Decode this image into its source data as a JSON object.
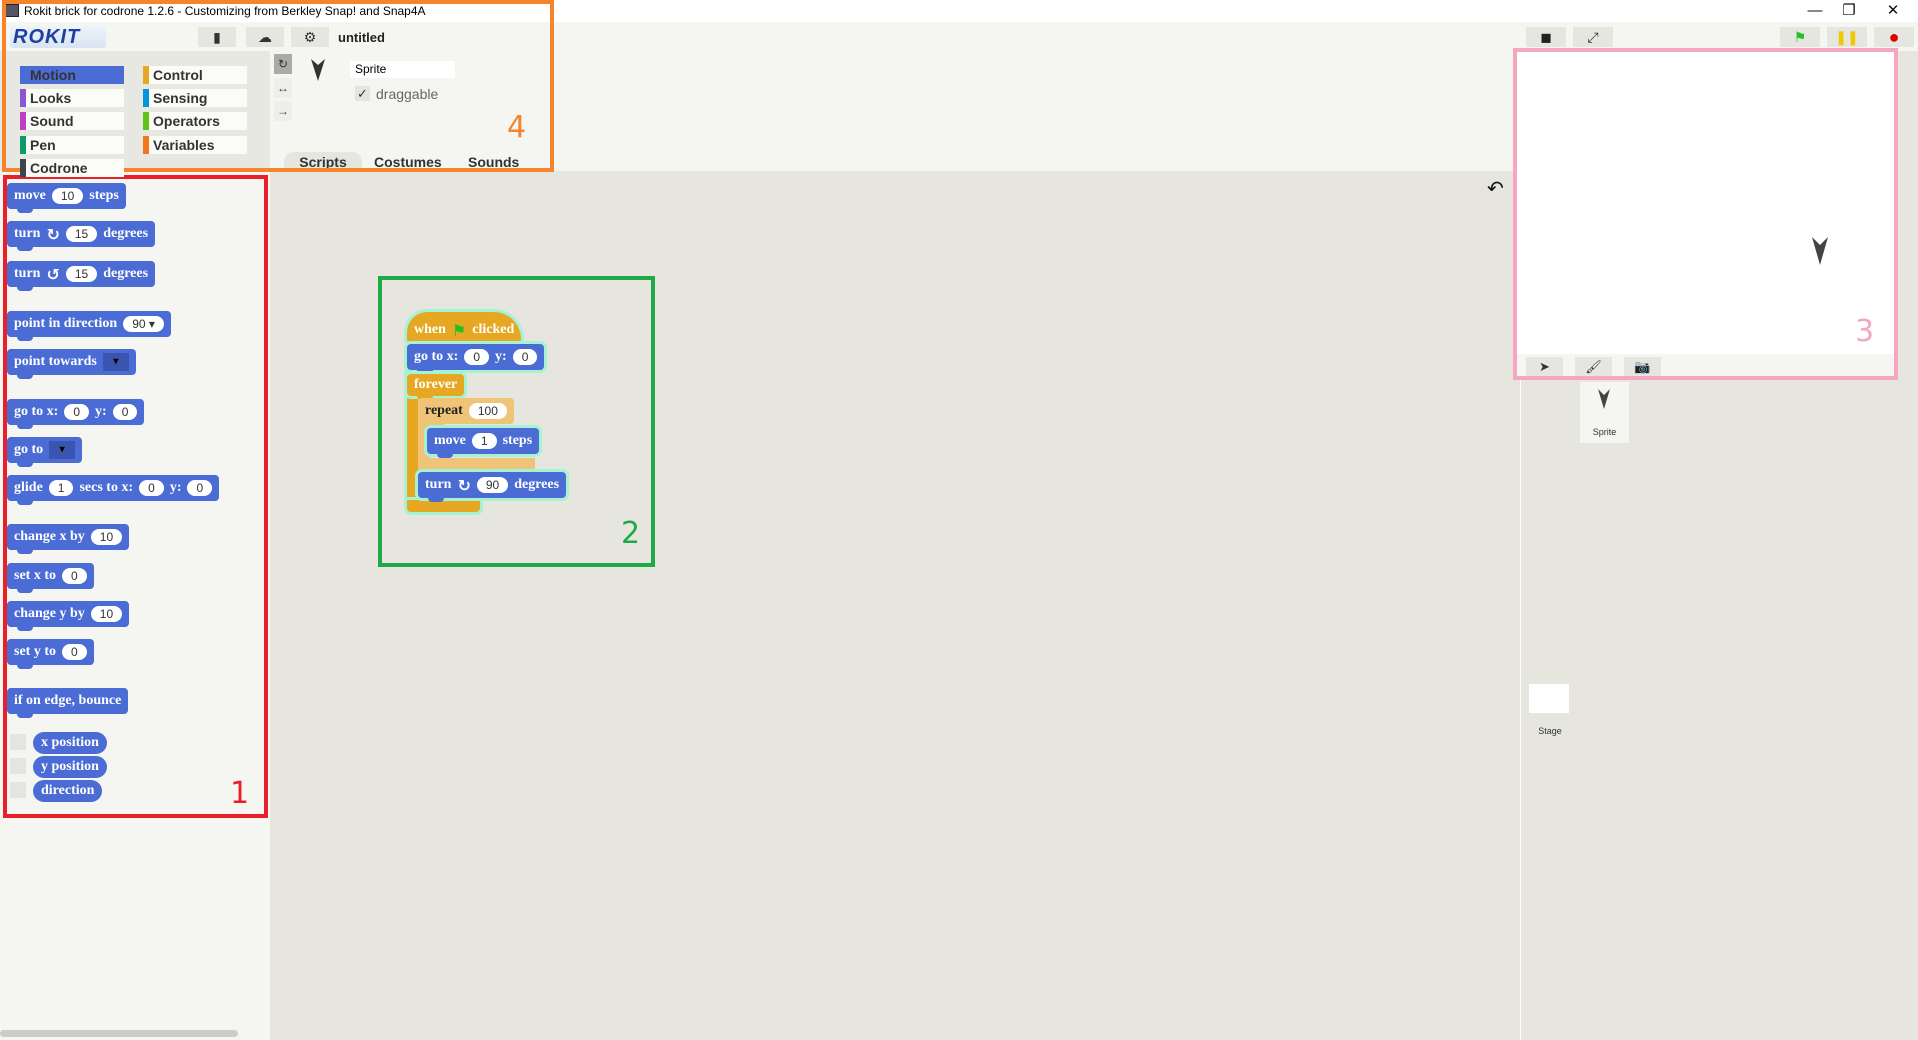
{
  "window": {
    "title": "Rokit brick for codrone 1.2.6 - Customizing from Berkley Snap! and Snap4A",
    "minimize": "—",
    "restore": "❐",
    "close": "✕"
  },
  "topbar": {
    "logo": "ROKIT",
    "new_icon": "file-icon",
    "cloud_icon": "cloud-icon",
    "settings_icon": "gear-icon",
    "project_name": "untitled"
  },
  "categories": [
    {
      "label": "Motion",
      "color": "#4a6cd4",
      "selected": true
    },
    {
      "label": "Looks",
      "color": "#8a55d7"
    },
    {
      "label": "Sound",
      "color": "#bb42c3"
    },
    {
      "label": "Pen",
      "color": "#0e9a6c"
    },
    {
      "label": "Codrone",
      "color": "#3c4650"
    },
    {
      "label": "Control",
      "color": "#e6a822"
    },
    {
      "label": "Sensing",
      "color": "#0494dc"
    },
    {
      "label": "Operators",
      "color": "#62c213"
    },
    {
      "label": "Variables",
      "color": "#f3761d"
    }
  ],
  "sprite": {
    "name": "Sprite",
    "draggable_label": "draggable",
    "draggable_checked": true,
    "check": "✓",
    "rotation_buttons": [
      "↻",
      "↔",
      "→"
    ]
  },
  "tabs": [
    {
      "label": "Scripts",
      "selected": true
    },
    {
      "label": "Costumes"
    },
    {
      "label": "Sounds"
    }
  ],
  "palette": {
    "blocks": [
      {
        "parts": [
          "move",
          {
            "input": "10"
          },
          "steps"
        ]
      },
      {
        "parts": [
          "turn",
          {
            "icon": "↻"
          },
          {
            "input": "15"
          },
          "degrees"
        ]
      },
      {
        "parts": [
          "turn",
          {
            "icon": "↺"
          },
          {
            "input": "15"
          },
          "degrees"
        ]
      },
      {
        "parts": [
          "point in direction",
          {
            "input": "90 ▾"
          }
        ]
      },
      {
        "parts": [
          "point towards",
          {
            "dropdown": "▾"
          }
        ]
      },
      {
        "parts": [
          "go to x:",
          {
            "input": "0"
          },
          "y:",
          {
            "input": "0"
          }
        ]
      },
      {
        "parts": [
          "go to",
          {
            "dropdown": "▾"
          }
        ]
      },
      {
        "parts": [
          "glide",
          {
            "input": "1"
          },
          "secs to x:",
          {
            "input": "0"
          },
          "y:",
          {
            "input": "0"
          }
        ]
      },
      {
        "parts": [
          "change x by",
          {
            "input": "10"
          }
        ]
      },
      {
        "parts": [
          "set x to",
          {
            "input": "0"
          }
        ]
      },
      {
        "parts": [
          "change y by",
          {
            "input": "10"
          }
        ]
      },
      {
        "parts": [
          "set y to",
          {
            "input": "0"
          }
        ]
      },
      {
        "parts": [
          "if on edge, bounce"
        ]
      }
    ],
    "reporters": [
      "x position",
      "y position",
      "direction"
    ]
  },
  "script": {
    "blocks": [
      {
        "parts": [
          "when",
          {
            "icon": "⚑"
          },
          "clicked"
        ]
      },
      {
        "parts": [
          "go to x:",
          {
            "input": "0"
          },
          "y:",
          {
            "input": "0"
          }
        ]
      },
      {
        "parts": [
          "forever"
        ]
      },
      {
        "parts": [
          "repeat",
          {
            "input": "100"
          }
        ]
      },
      {
        "parts": [
          "move",
          {
            "input": "1"
          },
          "steps"
        ]
      },
      {
        "parts": [
          "turn",
          {
            "icon": "↻"
          },
          {
            "input": "90"
          },
          "degrees"
        ]
      }
    ]
  },
  "annotations": {
    "palette": "1",
    "script": "2",
    "stage": "3",
    "header": "4"
  },
  "annotation_colors": {
    "palette": "#e8202a",
    "script": "#1faa4a",
    "stage": "#f6a6c0",
    "header": "#f5842a"
  },
  "stage_controls": {
    "stage_size_icon": "stage-size-icon",
    "fullscreen": "⤢",
    "green_flag": "⚑",
    "pause": "❚❚",
    "stop": "●"
  },
  "stage_colors": {
    "flag": "#22c022",
    "pause": "#f0c800",
    "stop": "#e00000"
  },
  "sprite_bar": {
    "turtle": "➤",
    "paint": "🖌",
    "camera": "📷"
  },
  "corral": {
    "sprite_label": "Sprite",
    "stage_label": "Stage"
  },
  "undo": "↶"
}
